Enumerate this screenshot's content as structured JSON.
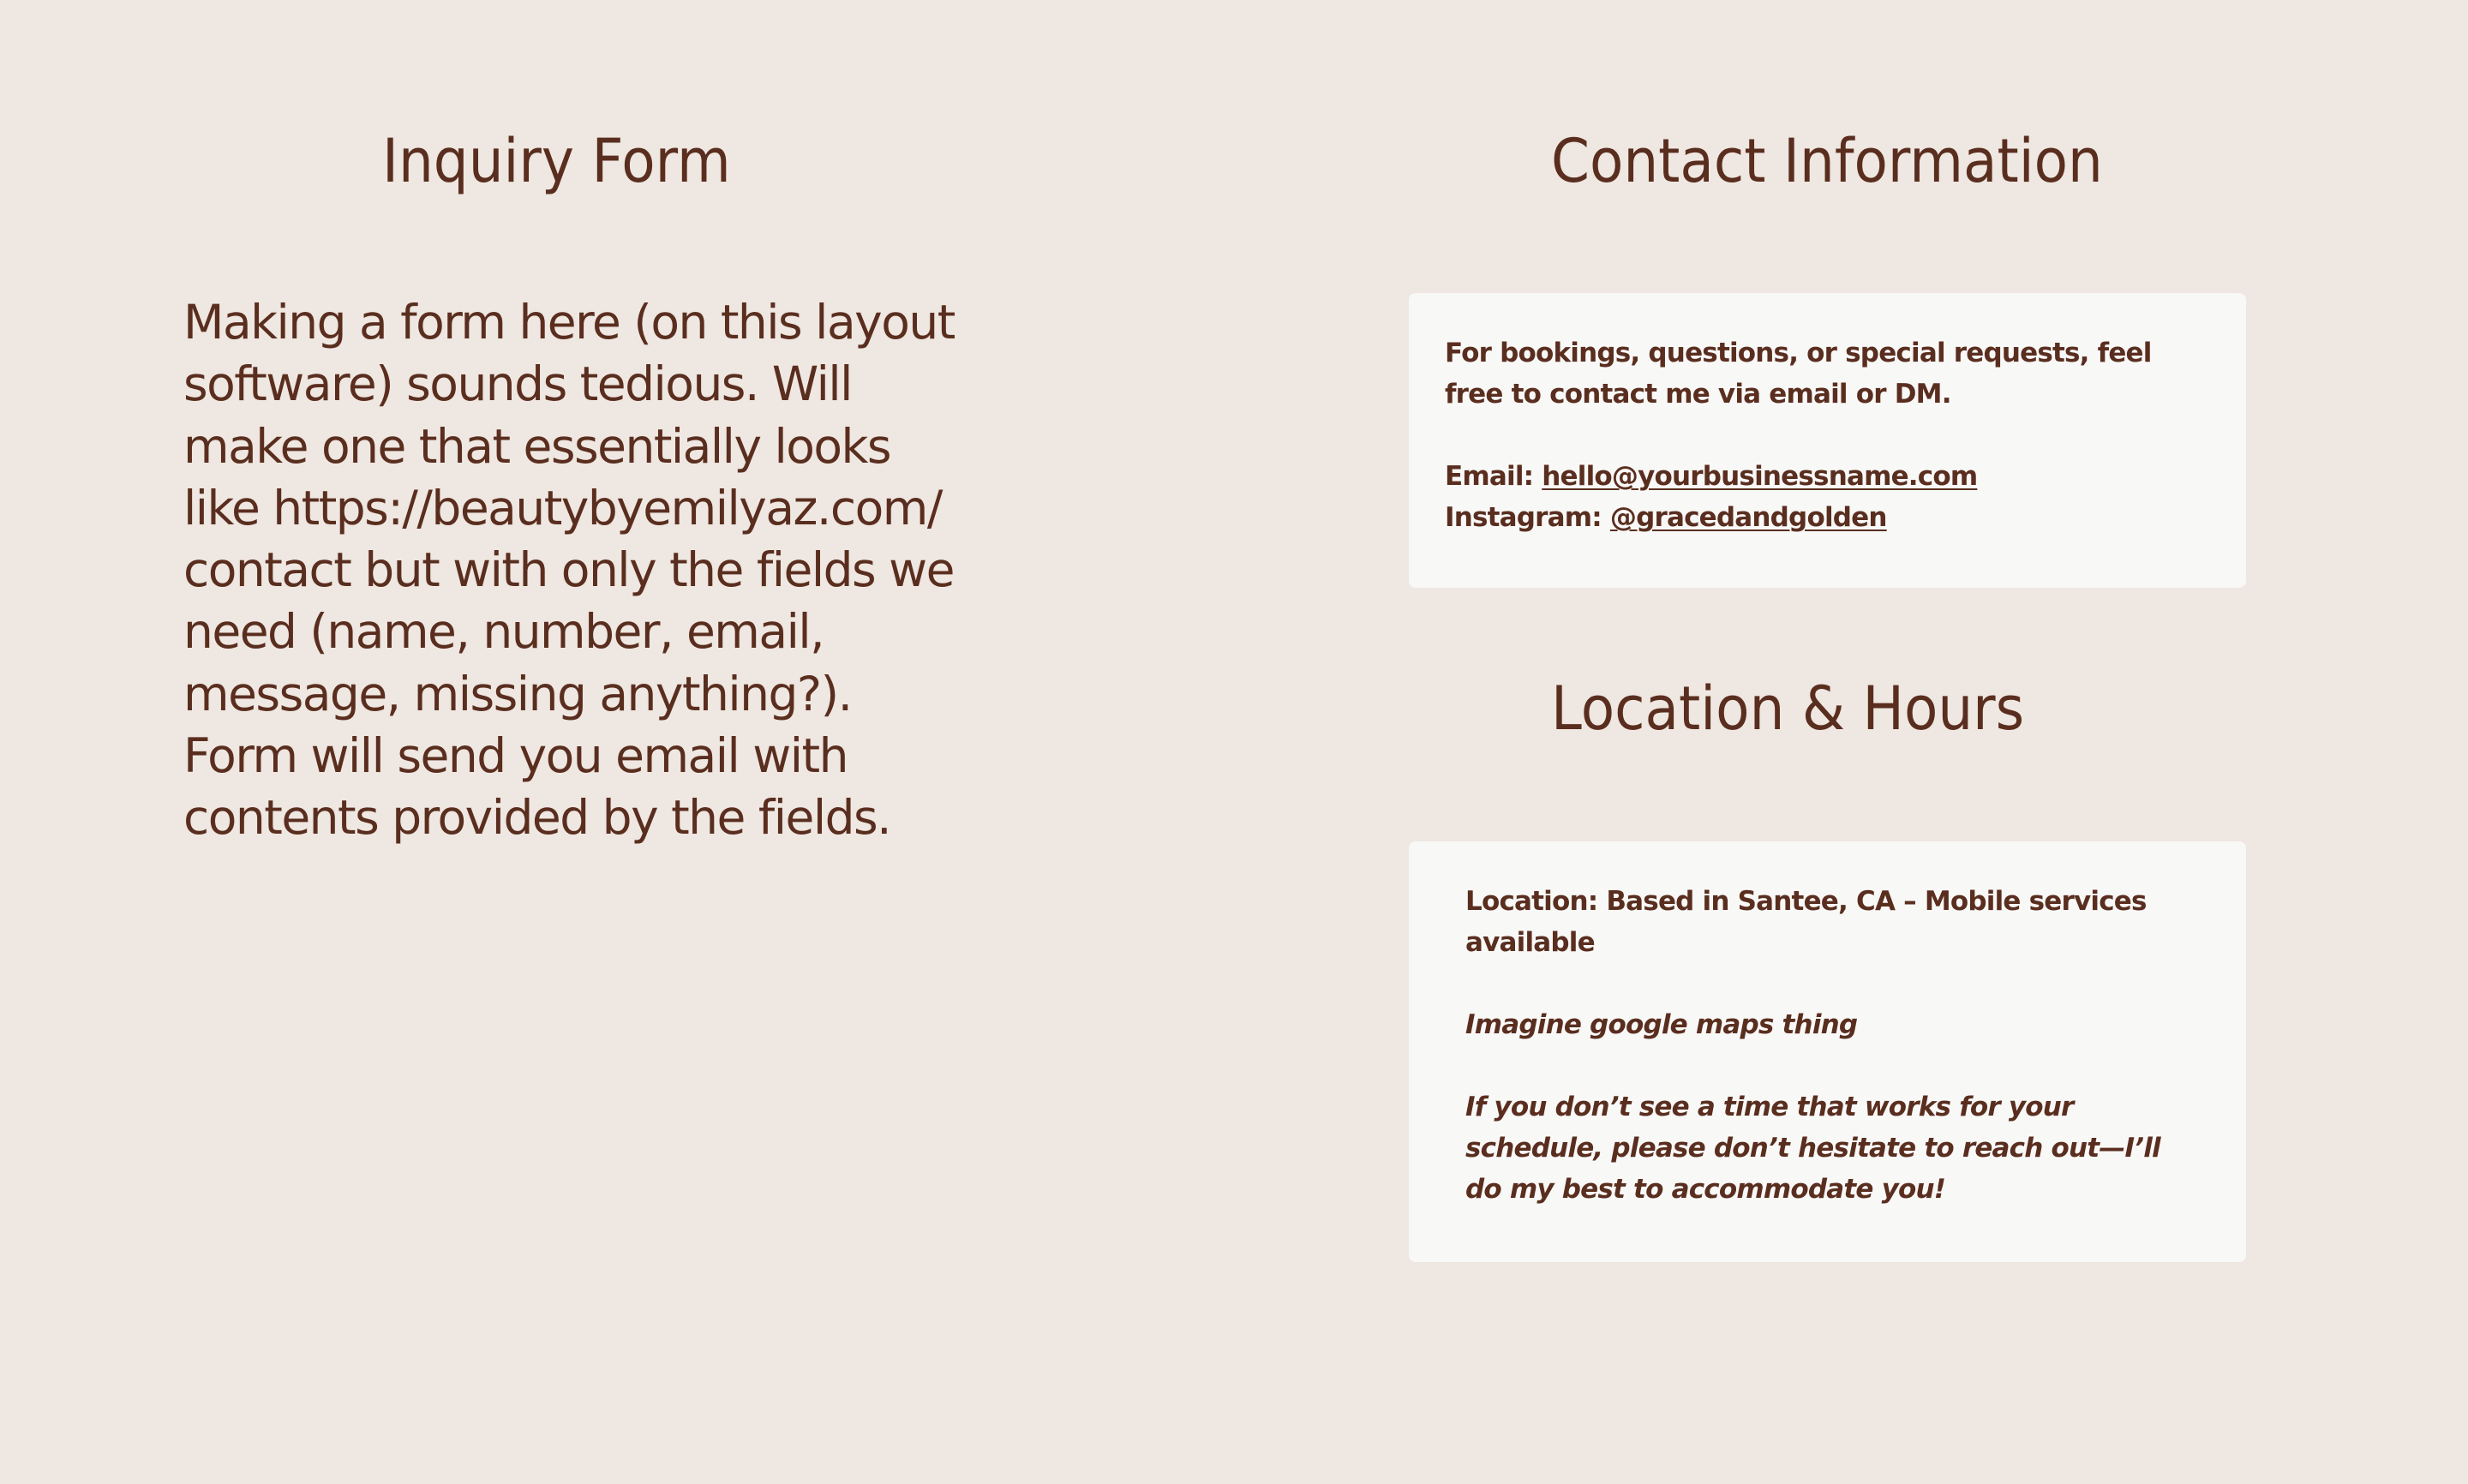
{
  "inquiry": {
    "title": "Inquiry Form",
    "note": "Making a form here (on this layout software) sounds tedious. Will make one that essentially looks like https://beautybyemilyaz.com/ contact but with only the fields we need (name, number, email, message, missing anything?). Form will send you email with contents provided by the fields."
  },
  "contact": {
    "title": "Contact Information",
    "intro": "For bookings, questions, or special requests, feel free to contact me via email or DM.",
    "email_label": "Email: ",
    "email_value": "hello@yourbusinessname.com",
    "instagram_label": "Instagram: ",
    "instagram_value": "@gracedandgolden"
  },
  "location": {
    "title": "Location & Hours",
    "location_text": "Location: Based in Santee, CA – Mobile services available",
    "map_placeholder": "Imagine google maps thing",
    "schedule_note": "If you don’t see a time that works for your schedule, please don’t hesitate to reach out—I’ll do my best to accommodate you!"
  },
  "colors": {
    "background": "#efe7e1",
    "card": "#f8f8f7",
    "text": "#5a2e1f"
  }
}
